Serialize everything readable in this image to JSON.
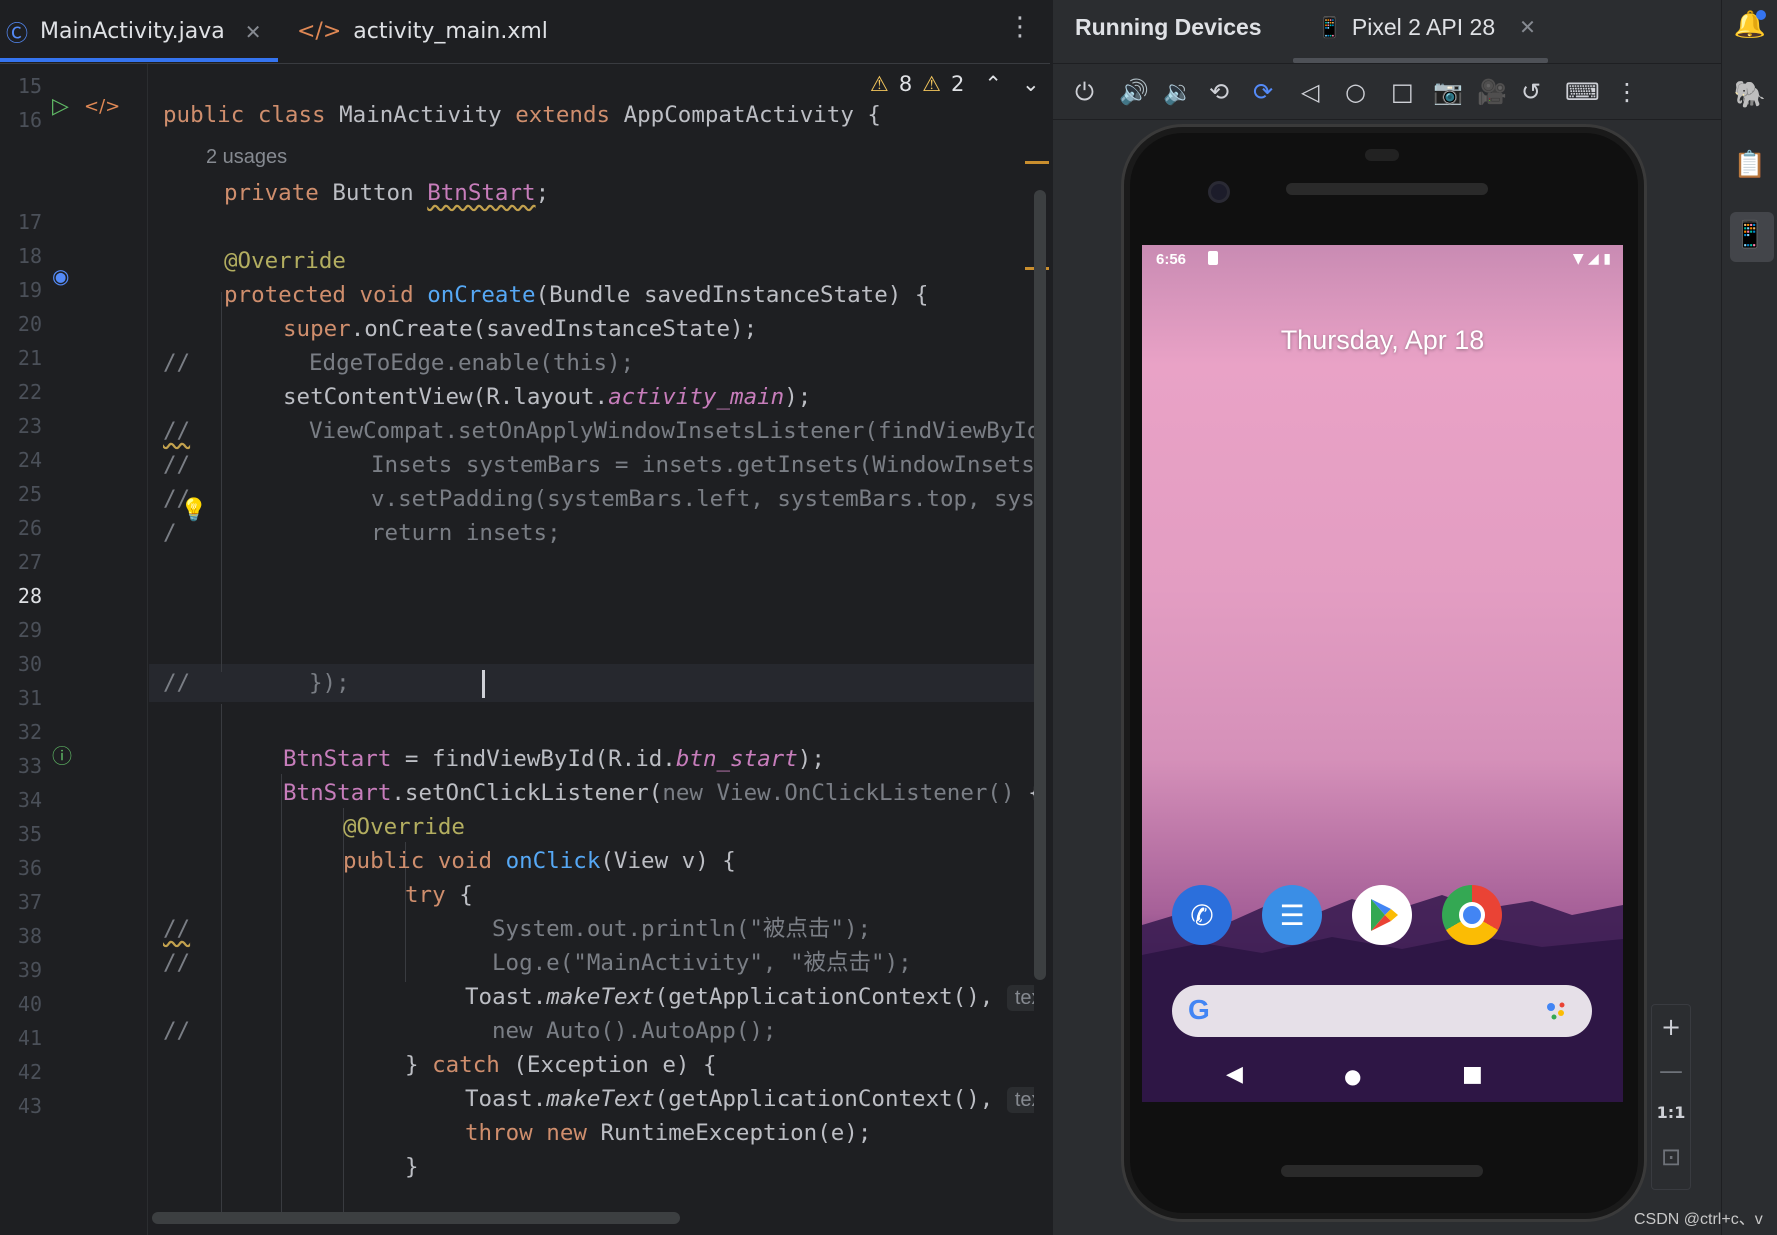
{
  "tabs": [
    {
      "label": "MainActivity.java",
      "icon": "java-class-icon",
      "active": true
    },
    {
      "label": "activity_main.xml",
      "icon": "xml-icon",
      "active": false
    }
  ],
  "inspections": {
    "warnings": "8",
    "weak_warnings": "2"
  },
  "usages_hint": "2 usages",
  "line_numbers": [
    "15",
    "16",
    "17",
    "18",
    "19",
    "20",
    "21",
    "22",
    "23",
    "24",
    "25",
    "26",
    "27",
    "28",
    "29",
    "30",
    "31",
    "32",
    "33",
    "34",
    "35",
    "36",
    "37",
    "38",
    "39",
    "40",
    "41",
    "42",
    "43"
  ],
  "current_line": "28",
  "code": {
    "l16": [
      "public class ",
      "MainActivity ",
      "extends ",
      "AppCompatActivity {"
    ],
    "l17": [
      "private ",
      "Button ",
      "BtnStart",
      ";"
    ],
    "l19": "@Override",
    "l20": [
      "protected void ",
      "onCreate",
      "(Bundle savedInstanceState) {"
    ],
    "l21": [
      "super",
      ".onCreate(savedInstanceState);"
    ],
    "l22": [
      "//",
      "EdgeToEdge.enable(this);"
    ],
    "l23": [
      "setContentView(R.layout.",
      "activity_main",
      ");"
    ],
    "l24": [
      "//",
      "ViewCompat.setOnApplyWindowInsetsListener(findViewById"
    ],
    "l25": [
      "//",
      "Insets systemBars = insets.getInsets(WindowInsetsCo"
    ],
    "l26": [
      "//",
      "v.setPadding(systemBars.left, systemBars.top, syste"
    ],
    "l27": [
      "/",
      "return insets;"
    ],
    "l28": [
      "//",
      "});"
    ],
    "l31": [
      "BtnStart",
      " = findViewById(R.id.",
      "btn_start",
      ");"
    ],
    "l32": [
      "BtnStart",
      ".setOnClickListener(",
      "new View.OnClickListener() ",
      "{"
    ],
    "l33": "@Override",
    "l34": [
      "public void ",
      "onClick",
      "(View v) {"
    ],
    "l35": [
      "try ",
      "{"
    ],
    "l36": [
      "//",
      "System.out.println(\"被点击\");"
    ],
    "l37": [
      "//",
      "Log.e(\"MainActivity\", \"被点击\");"
    ],
    "l38": [
      "Toast.",
      "makeText",
      "(getApplicationContext(),",
      "text:"
    ],
    "l39": [
      "//",
      "new Auto().AutoApp();"
    ],
    "l40": [
      "} ",
      "catch ",
      "(Exception e) {"
    ],
    "l41": [
      "Toast.",
      "makeText",
      "(getApplicationContext(),",
      "text:"
    ],
    "l42": [
      "throw new ",
      "RuntimeException(e);"
    ],
    "l43": "}"
  },
  "devices_panel": {
    "title": "Running Devices",
    "device_tab": "Pixel 2 API 28",
    "toolbar_icons": [
      "power-icon",
      "volume-up-icon",
      "volume-down-icon",
      "rotate-left-icon",
      "rotate-right-icon",
      "back-icon",
      "home-icon",
      "overview-icon",
      "screenshot-icon",
      "screen-record-icon",
      "reset-icon",
      "keyboard-icon",
      "more-icon"
    ]
  },
  "phone": {
    "time": "6:56",
    "date": "Thursday, Apr 18",
    "apps": [
      "phone-app-icon",
      "messages-app-icon",
      "play-store-app-icon",
      "chrome-app-icon"
    ],
    "search_logo": "G"
  },
  "zoom": {
    "in": "+",
    "out": "—",
    "one_to_one": "1:1"
  },
  "watermark": "CSDN @ctrl+c、v",
  "colors": {
    "accent": "#3574f0",
    "keyword": "#cf8e6d",
    "function": "#56a8f5",
    "annotation": "#b3ae60",
    "field": "#c77dbb",
    "comment": "#7a7e85"
  }
}
